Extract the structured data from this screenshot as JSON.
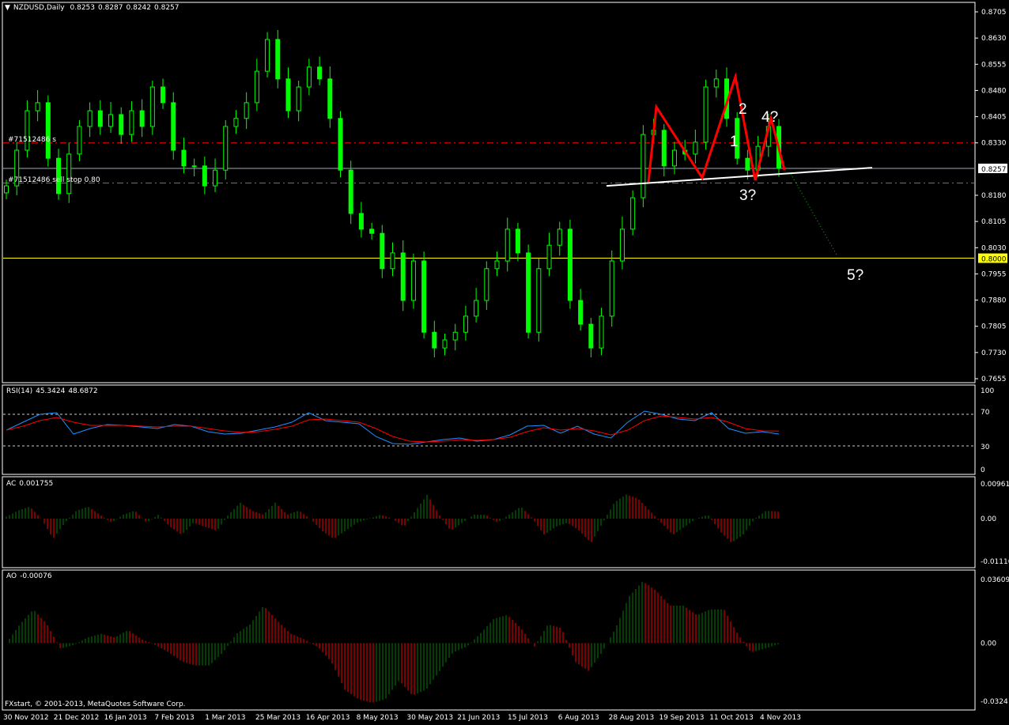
{
  "header": {
    "symbol": "NZDUSD,Daily",
    "ohlc": [
      "0.8253",
      "0.8287",
      "0.8242",
      "0.8257"
    ]
  },
  "colors": {
    "background": "#000000",
    "candle": "#00ff00",
    "rsi": "#1e90ff",
    "rsi_signal": "#ff0000",
    "wave_line": "#ff0000",
    "trendline": "#ffffff",
    "target_line": "#00c000",
    "order_line": "#ff0000",
    "stop_line": "#00c000",
    "level_0_8000": "#ffff00",
    "ac_up": "#008000",
    "ac_down": "#ff0000"
  },
  "annotations": {
    "order_label": "#71512486 s",
    "stop_label": "#71512486 sell stop 0.80",
    "waves": [
      "1",
      "2",
      "3?",
      "4?",
      "5?"
    ]
  },
  "copyright": "FXstart, © 2001-2013, MetaQuotes Software Corp.",
  "chart_data": [
    {
      "type": "candlestick",
      "title": "NZDUSD,Daily",
      "ylim": [
        0.7655,
        0.8705
      ],
      "y_ticks": [
        "0.8705",
        "0.8630",
        "0.8555",
        "0.8480",
        "0.8405",
        "0.8330",
        "0.8180",
        "0.8105",
        "0.8030",
        "0.7955",
        "0.7880",
        "0.7805",
        "0.7730",
        "0.7655"
      ],
      "price_labels": {
        "current": "0.8257",
        "level": "0.8000"
      },
      "x_ticks": [
        "30 Nov 2012",
        "21 Dec 2012",
        "16 Jan 2013",
        "7 Feb 2013",
        "1 Mar 2013",
        "25 Mar 2013",
        "16 Apr 2013",
        "8 May 2013",
        "30 May 2013",
        "21 Jun 2013",
        "15 Jul 2013",
        "6 Aug 2013",
        "28 Aug 2013",
        "19 Sep 2013",
        "11 Oct 2013",
        "4 Nov 2013"
      ],
      "close_sampled": [
        0.8207,
        0.8309,
        0.8422,
        0.8445,
        0.8286,
        0.8185,
        0.8298,
        0.8377,
        0.8422,
        0.8377,
        0.8411,
        0.8354,
        0.8422,
        0.8377,
        0.849,
        0.8445,
        0.8309,
        0.8264,
        0.8264,
        0.8207,
        0.8252,
        0.8377,
        0.84,
        0.8445,
        0.8535,
        0.8626,
        0.8513,
        0.8422,
        0.849,
        0.8547,
        0.8513,
        0.84,
        0.8252,
        0.8128,
        0.8083,
        0.8071,
        0.797,
        0.8015,
        0.7879,
        0.7992,
        0.7788,
        0.7743,
        0.7766,
        0.7788,
        0.7834,
        0.7879,
        0.797,
        0.7992,
        0.8083,
        0.8015,
        0.7788,
        0.797,
        0.8037,
        0.8083,
        0.7879,
        0.7811,
        0.7743,
        0.7834,
        0.7992,
        0.8083,
        0.8173,
        0.8354,
        0.8366,
        0.8264,
        0.8309,
        0.8298,
        0.8332,
        0.849,
        0.8513,
        0.84,
        0.8286,
        0.8252,
        0.832,
        0.8377,
        0.8257
      ],
      "wave_points": [
        0.8218,
        0.8433,
        0.823,
        0.8519,
        0.8223,
        0.84,
        0.8253
      ],
      "horizontal_lines": [
        0.833,
        0.8257,
        0.8215,
        0.8
      ]
    },
    {
      "type": "line",
      "title": "RSI(14)",
      "values_label": [
        "45.3424",
        "48.6872"
      ],
      "ylim": [
        0,
        100
      ],
      "y_ticks": [
        "100",
        "70",
        "30",
        "0"
      ],
      "levels": [
        70,
        30
      ],
      "series": [
        {
          "name": "RSI(14)",
          "values": [
            50,
            60,
            70,
            72,
            45,
            52,
            57,
            56,
            54,
            52,
            57,
            55,
            48,
            45,
            46,
            50,
            54,
            60,
            72,
            62,
            60,
            58,
            42,
            33,
            32,
            35,
            38,
            40,
            36,
            38,
            44,
            55,
            56,
            46,
            55,
            45,
            40,
            60,
            74,
            70,
            64,
            62,
            72,
            52,
            46,
            48,
            45
          ]
        },
        {
          "values": [
            50,
            55,
            62,
            66,
            60,
            56,
            56,
            56,
            55,
            54,
            55,
            55,
            52,
            49,
            47,
            48,
            51,
            55,
            63,
            64,
            62,
            60,
            52,
            42,
            36,
            35,
            36,
            38,
            37,
            38,
            41,
            48,
            53,
            50,
            52,
            49,
            44,
            50,
            62,
            68,
            66,
            64,
            66,
            60,
            52,
            49,
            48.7
          ]
        }
      ]
    },
    {
      "type": "bar",
      "title": "AC",
      "value_label": "0.001755",
      "ylim": [
        -0.01116,
        0.009612
      ],
      "y_ticks": [
        "0.009612",
        "0.00",
        "-0.01116"
      ],
      "values": [
        0.0005,
        0.002,
        0.003,
        0.0,
        -0.005,
        -0.001,
        0.002,
        0.003,
        0.001,
        -0.001,
        0.001,
        0.002,
        -0.001,
        0.001,
        -0.002,
        -0.004,
        -0.001,
        -0.002,
        -0.003,
        0.001,
        0.004,
        0.002,
        0.001,
        0.004,
        0.001,
        0.002,
        0.0,
        -0.003,
        -0.005,
        -0.003,
        -0.001,
        0.0,
        0.001,
        0.0,
        -0.002,
        0.002,
        0.006,
        0.001,
        -0.003,
        -0.001,
        0.001,
        0.001,
        -0.001,
        0.001,
        0.003,
        0.0,
        -0.004,
        -0.002,
        -0.001,
        -0.003,
        -0.006,
        -0.001,
        0.004,
        0.006,
        0.005,
        0.002,
        -0.001,
        -0.004,
        -0.002,
        0.0,
        0.001,
        -0.003,
        -0.006,
        -0.004,
        0.0,
        0.002,
        0.001755
      ]
    },
    {
      "type": "bar",
      "title": "AO",
      "value_label": "-0.00076",
      "ylim": [
        -0.0324,
        0.03609
      ],
      "y_ticks": [
        "0.03609",
        "0.00",
        "-0.0324"
      ],
      "values": [
        0.0,
        0.01,
        0.018,
        0.01,
        -0.003,
        -0.001,
        0.003,
        0.005,
        0.003,
        0.007,
        0.002,
        -0.001,
        -0.005,
        -0.01,
        -0.012,
        -0.012,
        -0.005,
        0.005,
        0.01,
        0.02,
        0.012,
        0.005,
        0.002,
        -0.002,
        -0.01,
        -0.025,
        -0.03,
        -0.032,
        -0.03,
        -0.02,
        -0.028,
        -0.025,
        -0.015,
        -0.005,
        -0.002,
        0.005,
        0.013,
        0.015,
        0.008,
        -0.002,
        0.01,
        0.008,
        -0.01,
        -0.015,
        -0.005,
        0.008,
        0.025,
        0.033,
        0.028,
        0.02,
        0.02,
        0.015,
        0.018,
        0.018,
        0.005,
        -0.005,
        -0.003,
        -0.00076
      ]
    }
  ]
}
